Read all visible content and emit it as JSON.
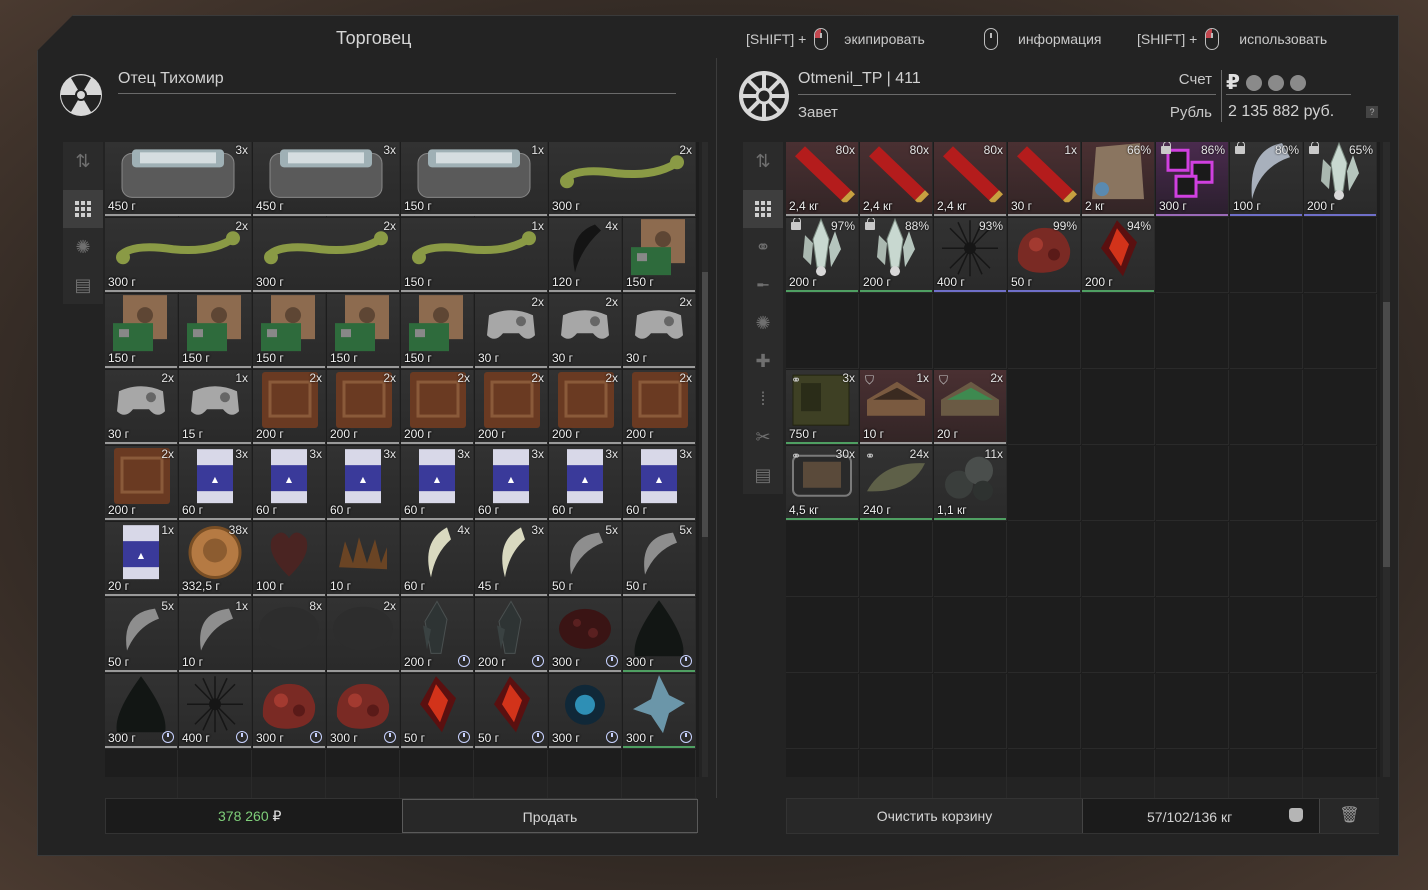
{
  "header": {
    "title": "Торговец",
    "hints": [
      {
        "prefix": "[SHIFT] +",
        "label": "экипировать",
        "mouse": "left-click-icon"
      },
      {
        "prefix": "",
        "label": "информация",
        "mouse": "right-click-icon"
      },
      {
        "prefix": "[SHIFT] +",
        "label": "использовать",
        "mouse": "left-click-icon"
      }
    ]
  },
  "trader": {
    "name": "Отец Тихомир",
    "icon": "radiation-icon"
  },
  "player": {
    "name": "Otmenil_TP | 411",
    "faction": "Завет",
    "account_label": "Счет",
    "currency_label": "Рубль",
    "money": "2 135 882 руб.",
    "help": "?"
  },
  "colors": {
    "accent_green": "#7fcf7a",
    "rarity_purple": "#9a6ab8",
    "cell_border": "#9a9a9a"
  },
  "left_tools": [
    "sort-icon",
    "grid-icon",
    "artifact-icon",
    "box-icon"
  ],
  "right_tools": [
    "sort-icon",
    "grid-icon",
    "link-icon",
    "rifle-icon",
    "artifact-icon",
    "medkit-icon",
    "ammo-icon",
    "tools-icon",
    "box-icon"
  ],
  "trader_items": [
    {
      "name": "tin-can",
      "cnt": "3x",
      "wt": "450 г",
      "col": 0,
      "row": 0
    },
    {
      "name": "tin-can",
      "cnt": "3x",
      "wt": "450 г",
      "col": 2,
      "row": 0
    },
    {
      "name": "tin-can",
      "cnt": "1x",
      "wt": "150 г",
      "col": 4,
      "row": 0
    },
    {
      "name": "bone",
      "cnt": "2x",
      "wt": "300 г",
      "col": 6,
      "row": 0
    },
    {
      "name": "bone",
      "cnt": "2x",
      "wt": "300 г",
      "col": 0,
      "row": 1
    },
    {
      "name": "bone",
      "cnt": "2x",
      "wt": "300 г",
      "col": 2,
      "row": 1
    },
    {
      "name": "bone",
      "cnt": "1x",
      "wt": "150 г",
      "col": 4,
      "row": 1
    },
    {
      "name": "claw",
      "cnt": "4x",
      "wt": "120 г",
      "col": 6,
      "row": 1
    },
    {
      "name": "circuit-board",
      "cnt": "",
      "wt": "150 г",
      "col": 7,
      "row": 1
    },
    {
      "name": "circuit-board",
      "cnt": "",
      "wt": "150 г",
      "col": 0,
      "row": 2
    },
    {
      "name": "circuit-board",
      "cnt": "",
      "wt": "150 г",
      "col": 1,
      "row": 2
    },
    {
      "name": "circuit-board",
      "cnt": "",
      "wt": "150 г",
      "col": 2,
      "row": 2
    },
    {
      "name": "circuit-board",
      "cnt": "",
      "wt": "150 г",
      "col": 3,
      "row": 2
    },
    {
      "name": "circuit-board",
      "cnt": "",
      "wt": "150 г",
      "col": 4,
      "row": 2
    },
    {
      "name": "gamepad",
      "cnt": "2x",
      "wt": "30 г",
      "col": 5,
      "row": 2
    },
    {
      "name": "gamepad",
      "cnt": "2x",
      "wt": "30 г",
      "col": 6,
      "row": 2
    },
    {
      "name": "gamepad",
      "cnt": "2x",
      "wt": "30 г",
      "col": 7,
      "row": 2
    },
    {
      "name": "gamepad",
      "cnt": "2x",
      "wt": "30 г",
      "col": 0,
      "row": 3
    },
    {
      "name": "gamepad",
      "cnt": "1x",
      "wt": "15 г",
      "col": 1,
      "row": 3
    },
    {
      "name": "leather-book",
      "cnt": "2x",
      "wt": "200 г",
      "col": 2,
      "row": 3
    },
    {
      "name": "leather-book",
      "cnt": "2x",
      "wt": "200 г",
      "col": 3,
      "row": 3
    },
    {
      "name": "leather-book",
      "cnt": "2x",
      "wt": "200 г",
      "col": 4,
      "row": 3
    },
    {
      "name": "leather-book",
      "cnt": "2x",
      "wt": "200 г",
      "col": 5,
      "row": 3
    },
    {
      "name": "leather-book",
      "cnt": "2x",
      "wt": "200 г",
      "col": 6,
      "row": 3
    },
    {
      "name": "leather-book",
      "cnt": "2x",
      "wt": "200 г",
      "col": 7,
      "row": 3
    },
    {
      "name": "leather-book",
      "cnt": "2x",
      "wt": "200 г",
      "col": 0,
      "row": 4
    },
    {
      "name": "cigarettes",
      "cnt": "3x",
      "wt": "60 г",
      "col": 1,
      "row": 4
    },
    {
      "name": "cigarettes",
      "cnt": "3x",
      "wt": "60 г",
      "col": 2,
      "row": 4
    },
    {
      "name": "cigarettes",
      "cnt": "3x",
      "wt": "60 г",
      "col": 3,
      "row": 4
    },
    {
      "name": "cigarettes",
      "cnt": "3x",
      "wt": "60 г",
      "col": 4,
      "row": 4
    },
    {
      "name": "cigarettes",
      "cnt": "3x",
      "wt": "60 г",
      "col": 5,
      "row": 4
    },
    {
      "name": "cigarettes",
      "cnt": "3x",
      "wt": "60 г",
      "col": 6,
      "row": 4
    },
    {
      "name": "cigarettes",
      "cnt": "3x",
      "wt": "60 г",
      "col": 7,
      "row": 4
    },
    {
      "name": "cigarettes",
      "cnt": "1x",
      "wt": "20 г",
      "col": 0,
      "row": 5
    },
    {
      "name": "coin",
      "cnt": "38x",
      "wt": "332,5 г",
      "col": 1,
      "row": 5
    },
    {
      "name": "heart",
      "cnt": "",
      "wt": "100 г",
      "col": 2,
      "row": 5
    },
    {
      "name": "spiky-part",
      "cnt": "",
      "wt": "10 г",
      "col": 3,
      "row": 5
    },
    {
      "name": "fang",
      "cnt": "4x",
      "wt": "60 г",
      "col": 4,
      "row": 5
    },
    {
      "name": "fang",
      "cnt": "3x",
      "wt": "45 г",
      "col": 5,
      "row": 5
    },
    {
      "name": "claw-grey",
      "cnt": "5x",
      "wt": "50 г",
      "col": 6,
      "row": 5
    },
    {
      "name": "claw-grey",
      "cnt": "5x",
      "wt": "50 г",
      "col": 7,
      "row": 5
    },
    {
      "name": "claw-grey",
      "cnt": "5x",
      "wt": "50 г",
      "col": 0,
      "row": 6
    },
    {
      "name": "claw-grey",
      "cnt": "1x",
      "wt": "10 г",
      "col": 1,
      "row": 6
    },
    {
      "name": "fur",
      "cnt": "8x",
      "wt": "",
      "col": 2,
      "row": 6
    },
    {
      "name": "fur",
      "cnt": "2x",
      "wt": "",
      "col": 3,
      "row": 6
    },
    {
      "name": "dark-crystal",
      "cnt": "",
      "wt": "200 г",
      "col": 4,
      "row": 6,
      "clock": true
    },
    {
      "name": "dark-crystal",
      "cnt": "",
      "wt": "200 г",
      "col": 5,
      "row": 6,
      "clock": true
    },
    {
      "name": "red-moss",
      "cnt": "",
      "wt": "300 г",
      "col": 6,
      "row": 6,
      "clock": true
    },
    {
      "name": "dark-cone",
      "cnt": "",
      "wt": "300 г",
      "col": 7,
      "row": 6,
      "clock": true,
      "green": true
    },
    {
      "name": "dark-cone",
      "cnt": "",
      "wt": "300 г",
      "col": 0,
      "row": 7,
      "clock": true
    },
    {
      "name": "urchin",
      "cnt": "",
      "wt": "400 г",
      "col": 1,
      "row": 7,
      "clock": true
    },
    {
      "name": "red-flesh",
      "cnt": "",
      "wt": "300 г",
      "col": 2,
      "row": 7,
      "clock": true
    },
    {
      "name": "red-flesh",
      "cnt": "",
      "wt": "300 г",
      "col": 3,
      "row": 7,
      "clock": true
    },
    {
      "name": "lava-shard",
      "cnt": "",
      "wt": "50 г",
      "col": 4,
      "row": 7,
      "clock": true
    },
    {
      "name": "lava-shard",
      "cnt": "",
      "wt": "50 г",
      "col": 5,
      "row": 7,
      "clock": true
    },
    {
      "name": "blue-orb",
      "cnt": "",
      "wt": "300 г",
      "col": 6,
      "row": 7,
      "clock": true
    },
    {
      "name": "ice-crystal",
      "cnt": "",
      "wt": "300 г",
      "col": 7,
      "row": 7,
      "clock": true,
      "green": true
    }
  ],
  "player_items": [
    {
      "name": "shotgun-shells",
      "cnt": "80x",
      "wt": "2,4 кг",
      "col": 0,
      "row": 0,
      "red": true
    },
    {
      "name": "shotgun-shells",
      "cnt": "80x",
      "wt": "2,4 кг",
      "col": 1,
      "row": 0,
      "red": true
    },
    {
      "name": "shotgun-shells",
      "cnt": "80x",
      "wt": "2,4 кг",
      "col": 2,
      "row": 0,
      "red": true
    },
    {
      "name": "shotgun-shells",
      "cnt": "1x",
      "wt": "30 г",
      "col": 3,
      "row": 0,
      "red": true
    },
    {
      "name": "armor-plate",
      "cnt": "66%",
      "wt": "2 кг",
      "col": 4,
      "row": 0,
      "red": true
    },
    {
      "name": "purple-cubes",
      "cnt": "86%",
      "wt": "300 г",
      "col": 5,
      "row": 0,
      "purple": true,
      "lock": true
    },
    {
      "name": "horn",
      "cnt": "80%",
      "wt": "100 г",
      "col": 6,
      "row": 0,
      "lock": true,
      "blue": true
    },
    {
      "name": "crystal",
      "cnt": "65%",
      "wt": "200 г",
      "col": 7,
      "row": 0,
      "lock": true,
      "blue": true
    },
    {
      "name": "crystal",
      "cnt": "97%",
      "wt": "200 г",
      "col": 0,
      "row": 1,
      "lock": true,
      "green": true
    },
    {
      "name": "crystal",
      "cnt": "88%",
      "wt": "200 г",
      "col": 1,
      "row": 1,
      "lock": true,
      "green": true
    },
    {
      "name": "urchin",
      "cnt": "93%",
      "wt": "400 г",
      "col": 2,
      "row": 1,
      "blue": true
    },
    {
      "name": "red-flesh",
      "cnt": "99%",
      "wt": "50 г",
      "col": 3,
      "row": 1,
      "blue": true
    },
    {
      "name": "lava-shard",
      "cnt": "94%",
      "wt": "200 г",
      "col": 4,
      "row": 1,
      "green": true
    },
    {
      "name": "ammo-box",
      "cnt": "3x",
      "wt": "750 г",
      "col": 0,
      "row": 3,
      "green": true,
      "link": true
    },
    {
      "name": "roof-plate",
      "cnt": "1x",
      "wt": "10 г",
      "col": 1,
      "row": 3,
      "red": true,
      "shield": true
    },
    {
      "name": "roof-plate-green",
      "cnt": "2x",
      "wt": "20 г",
      "col": 2,
      "row": 3,
      "red": true,
      "shield": true
    },
    {
      "name": "tablet",
      "cnt": "30x",
      "wt": "4,5 кг",
      "col": 0,
      "row": 4,
      "green": true,
      "link": true
    },
    {
      "name": "leaf",
      "cnt": "24x",
      "wt": "240 г",
      "col": 1,
      "row": 4,
      "green": true,
      "link": true
    },
    {
      "name": "balls",
      "cnt": "11x",
      "wt": "1,1 кг",
      "col": 2,
      "row": 4,
      "green": true
    }
  ],
  "bottom": {
    "sum_value": "378 260",
    "sum_currency": "₽",
    "sell_label": "Продать",
    "clear_label": "Очистить корзину",
    "weight": "57/102/136 кг"
  }
}
